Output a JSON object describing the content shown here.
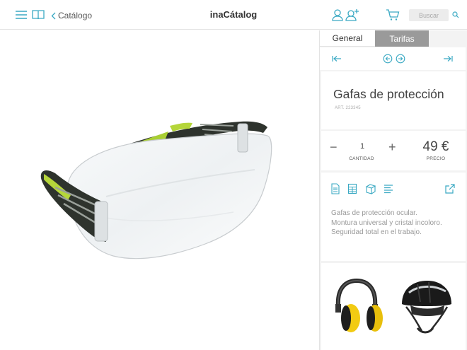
{
  "header": {
    "back_label": "Catálogo",
    "brand": "inaCátalog",
    "search_placeholder": "Buscar",
    "icons": [
      "menu-icon",
      "book-icon",
      "chevron-left-icon",
      "user-icon",
      "add-user-icon",
      "cart-icon",
      "search-icon"
    ],
    "accent_color": "#3aa9c3"
  },
  "tabs": [
    {
      "label": "General",
      "active": true
    },
    {
      "label": "Tarifas",
      "active": false
    }
  ],
  "navigation": {
    "icons": [
      "first-icon",
      "previous-icon",
      "next-icon",
      "last-icon"
    ]
  },
  "product": {
    "title": "Gafas de protección",
    "art": "ART. 223345",
    "quantity": "1",
    "quantity_label": "CANTIDAD",
    "price": "49 €",
    "price_label": "PRECIO",
    "description": [
      "Gafas de protección ocular.",
      "Montura universal y cristal incoloro.",
      "Seguridad total en el trabajo."
    ],
    "info_icons": [
      "document-icon",
      "table-icon",
      "box-icon",
      "text-lines-icon",
      "external-link-icon"
    ]
  },
  "related": [
    {
      "name": "ear-muffs"
    },
    {
      "name": "safety-helmet"
    }
  ]
}
